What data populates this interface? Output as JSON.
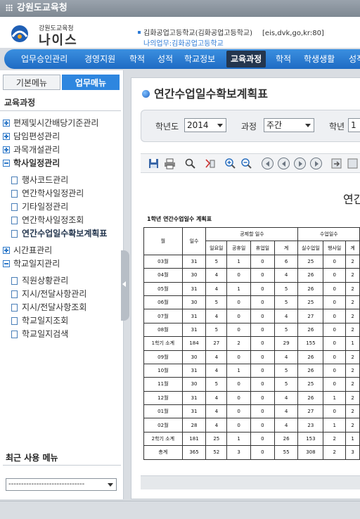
{
  "window": {
    "title": "강원도교육청"
  },
  "header": {
    "org_small": "강원도교육청",
    "org_big": "나이스",
    "school_line": "김화공업고등학교(김화공업고등학교)",
    "login": "[eis,dvk,go,kr:80]",
    "sub_line": "나의업무:김화공업고등학교"
  },
  "nav": {
    "items": [
      "업무승인관리",
      "경영지원",
      "학적",
      "성적",
      "학교정보",
      "교육과정",
      "학적",
      "학생생활",
      "성적"
    ],
    "active": "교육과정"
  },
  "left": {
    "tabs": {
      "basic": "기본메뉴",
      "work": "업무메뉴"
    },
    "section": "교육과정",
    "tree": [
      {
        "type": "plus",
        "label": "편제및시간배당기준관리"
      },
      {
        "type": "plus",
        "label": "담임편성관리"
      },
      {
        "type": "plus",
        "label": "과목개설관리"
      },
      {
        "type": "minus",
        "label": "학사일정관리",
        "bold": true
      },
      {
        "type": "doc",
        "label": "행사코드관리"
      },
      {
        "type": "doc",
        "label": "연간학사일정관리"
      },
      {
        "type": "doc",
        "label": "기타일정관리"
      },
      {
        "type": "doc",
        "label": "연간학사일정조회"
      },
      {
        "type": "doc",
        "label": "연간수업일수확보계획표",
        "selected": true
      },
      {
        "type": "plus",
        "label": "시간표관리"
      },
      {
        "type": "minus",
        "label": "학교일지관리"
      },
      {
        "type": "doc",
        "label": "직원상황관리"
      },
      {
        "type": "doc",
        "label": "지시/전달사항관리"
      },
      {
        "type": "doc",
        "label": "지시/전달사항조회"
      },
      {
        "type": "doc",
        "label": "학교일지조회"
      },
      {
        "type": "doc",
        "label": "학교일지검색"
      }
    ],
    "recent_title": "최근 사용 메뉴",
    "recent_value": "------------------------------"
  },
  "main": {
    "title": "연간수업일수확보계획표",
    "filters": {
      "year_label": "학년도",
      "year_value": "2014",
      "course_label": "과정",
      "course_value": "주간",
      "grade_label": "학년",
      "grade_value": "1"
    },
    "report_title": "연간",
    "table": {
      "caption": "1학년 연간수업일수 계획표",
      "headers": {
        "month": "월",
        "days": "일수",
        "excluded": "공제할 일수",
        "lesson_days": "수업일수",
        "sub": [
          "일요일",
          "공휴일",
          "휴업일",
          "계",
          "실수업일",
          "행사일",
          "계"
        ]
      },
      "rows": [
        [
          "03월",
          "31",
          "5",
          "1",
          "0",
          "6",
          "25",
          "0",
          "2"
        ],
        [
          "04월",
          "30",
          "4",
          "0",
          "0",
          "4",
          "26",
          "0",
          "2"
        ],
        [
          "05월",
          "31",
          "4",
          "1",
          "0",
          "5",
          "26",
          "0",
          "2"
        ],
        [
          "06월",
          "30",
          "5",
          "0",
          "0",
          "5",
          "25",
          "0",
          "2"
        ],
        [
          "07월",
          "31",
          "4",
          "0",
          "0",
          "4",
          "27",
          "0",
          "2"
        ],
        [
          "08월",
          "31",
          "5",
          "0",
          "0",
          "5",
          "26",
          "0",
          "2"
        ],
        [
          "1학기 소계",
          "184",
          "27",
          "2",
          "0",
          "29",
          "155",
          "0",
          "1"
        ],
        [
          "09월",
          "30",
          "4",
          "0",
          "0",
          "4",
          "26",
          "0",
          "2"
        ],
        [
          "10월",
          "31",
          "4",
          "1",
          "0",
          "5",
          "26",
          "0",
          "2"
        ],
        [
          "11월",
          "30",
          "5",
          "0",
          "0",
          "5",
          "25",
          "0",
          "2"
        ],
        [
          "12월",
          "31",
          "4",
          "0",
          "0",
          "4",
          "26",
          "1",
          "2"
        ],
        [
          "01월",
          "31",
          "4",
          "0",
          "0",
          "4",
          "27",
          "0",
          "2"
        ],
        [
          "02월",
          "28",
          "4",
          "0",
          "0",
          "4",
          "23",
          "1",
          "2"
        ],
        [
          "2학기 소계",
          "181",
          "25",
          "1",
          "0",
          "26",
          "153",
          "2",
          "1"
        ],
        [
          "총계",
          "365",
          "52",
          "3",
          "0",
          "55",
          "308",
          "2",
          "3"
        ]
      ]
    }
  }
}
